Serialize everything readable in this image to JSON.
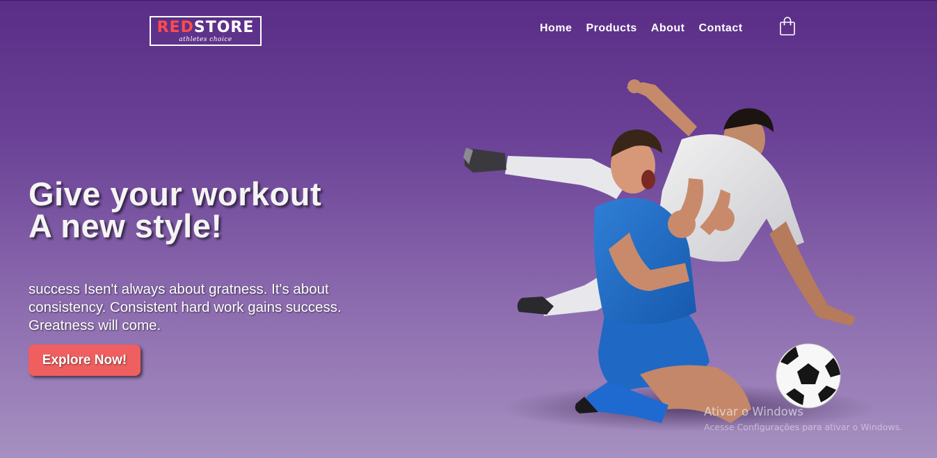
{
  "brand": {
    "logo_red": "RED",
    "logo_white": "STORE",
    "tagline": "athletes choice",
    "accent_color": "#ff4c4c"
  },
  "nav": {
    "items": [
      {
        "label": "Home"
      },
      {
        "label": "Products"
      },
      {
        "label": "About"
      },
      {
        "label": "Contact"
      }
    ],
    "cart_icon": "shopping-bag-icon"
  },
  "hero": {
    "title_line1": "Give your workout",
    "title_line2": "A new style!",
    "description": "success Isen't always about gratness. It's about consistency. Consistent hard work gains success. Greatness will come.",
    "cta_label": "Explore Now!",
    "cta_color": "#ef5f5f",
    "image": "football-players-image"
  },
  "watermark": {
    "title": "Ativar o Windows",
    "subtitle": "Acesse Configurações para ativar o Windows."
  }
}
